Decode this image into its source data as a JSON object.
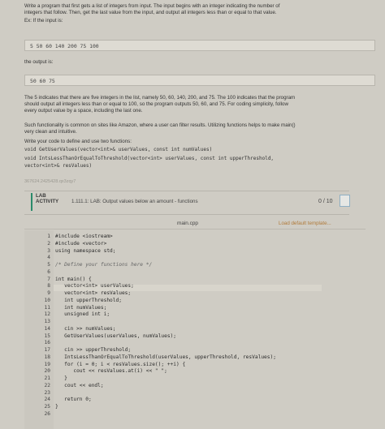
{
  "instructions": {
    "p1_line1": "Write a program that first gets a list of integers from input. The input begins with an integer indicating the number of",
    "p1_line2": "integers that follow. Then, get the last value from the input, and output all integers less than or equal to that value.",
    "ex_label": "Ex: If the input is:",
    "ex_input": "5 50 60 140 200 75 100",
    "out_label": "the output is:",
    "ex_output": "50 60 75",
    "p2_line1": "The 5 indicates that there are five integers in the list, namely 50, 60, 140, 200, and 75. The 100 indicates that the program",
    "p2_line2": "should output all integers less than or equal to 100, so the program outputs 50, 60, and 75. For coding simplicity, follow",
    "p2_line3": "every output value by a space, including the last one.",
    "p3_line1": "Such functionality is common on sites like Amazon, where a user can filter results. Utilizing functions helps to make main()",
    "p3_line2": "very clean and intuitive.",
    "p4": "Write your code to define and use two functions:",
    "func1": "void GetUserValues(vector<int>& userValues, const int numValues)",
    "func2": "void IntsLessThanOrEqualToThreshold(vector<int> userValues, const int upperThreshold,",
    "func2b": "vector<int>& resValues)",
    "id_code": "367624.2425428.qx3zqy7"
  },
  "lab": {
    "badge_line1": "LAB",
    "badge_line2": "ACTIVITY",
    "title": "1.111.1: LAB: Output values below an amount - functions",
    "score": "0 / 10"
  },
  "editor": {
    "filename": "main.cpp",
    "load_template": "Load default template...",
    "lines": [
      {
        "n": "1",
        "t": "#include <iostream>"
      },
      {
        "n": "2",
        "t": "#include <vector>"
      },
      {
        "n": "3",
        "t": "using namespace std;"
      },
      {
        "n": "4",
        "t": ""
      },
      {
        "n": "5",
        "t": "/* Define your functions here */"
      },
      {
        "n": "6",
        "t": ""
      },
      {
        "n": "7",
        "t": "int main() {"
      },
      {
        "n": "8",
        "t": "   vector<int> userValues;"
      },
      {
        "n": "9",
        "t": "   vector<int> resValues;"
      },
      {
        "n": "10",
        "t": "   int upperThreshold;"
      },
      {
        "n": "11",
        "t": "   int numValues;"
      },
      {
        "n": "12",
        "t": "   unsigned int i;"
      },
      {
        "n": "13",
        "t": ""
      },
      {
        "n": "14",
        "t": "   cin >> numValues;"
      },
      {
        "n": "15",
        "t": "   GetUserValues(userValues, numValues);"
      },
      {
        "n": "16",
        "t": ""
      },
      {
        "n": "17",
        "t": "   cin >> upperThreshold;"
      },
      {
        "n": "18",
        "t": "   IntsLessThanOrEqualToThreshold(userValues, upperThreshold, resValues);"
      },
      {
        "n": "19",
        "t": "   for (i = 0; i < resValues.size(); ++i) {"
      },
      {
        "n": "20",
        "t": "      cout << resValues.at(i) << \" \";"
      },
      {
        "n": "21",
        "t": "   }"
      },
      {
        "n": "22",
        "t": "   cout << endl;"
      },
      {
        "n": "23",
        "t": ""
      },
      {
        "n": "24",
        "t": "   return 0;"
      },
      {
        "n": "25",
        "t": "}"
      },
      {
        "n": "26",
        "t": ""
      }
    ]
  }
}
